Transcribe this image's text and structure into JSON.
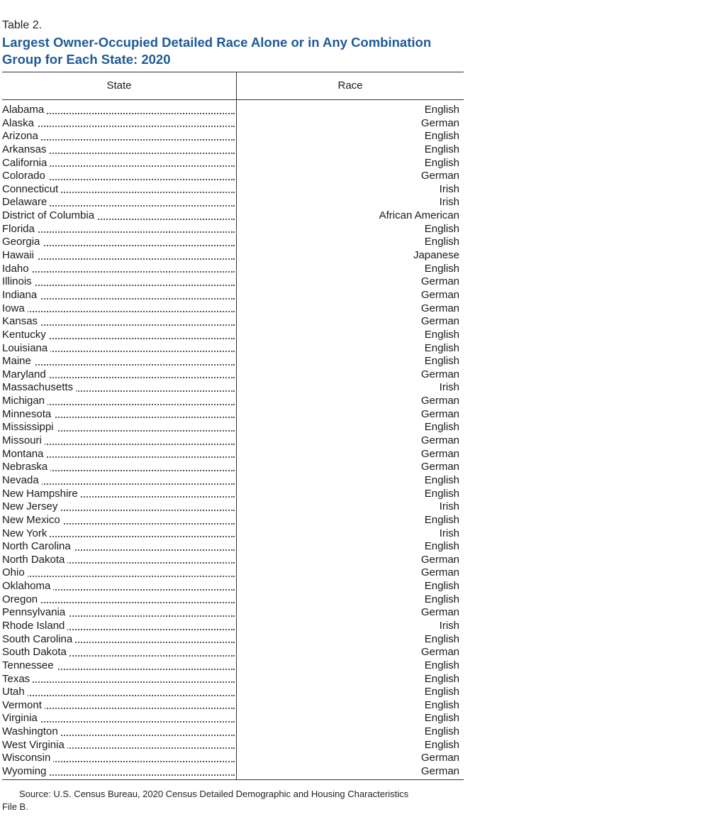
{
  "table_label": "Table 2.",
  "title": "Largest Owner-Occupied Detailed Race Alone or in Any Combination Group for Each State: 2020",
  "columns": {
    "state": "State",
    "race": "Race"
  },
  "rows": [
    {
      "state": "Alabama",
      "race": "English"
    },
    {
      "state": "Alaska",
      "race": "German"
    },
    {
      "state": "Arizona",
      "race": "English"
    },
    {
      "state": "Arkansas",
      "race": "English"
    },
    {
      "state": "California",
      "race": "English"
    },
    {
      "state": "Colorado",
      "race": "German"
    },
    {
      "state": "Connecticut",
      "race": "Irish"
    },
    {
      "state": "Delaware",
      "race": "Irish"
    },
    {
      "state": "District of Columbia",
      "race": "African American"
    },
    {
      "state": "Florida",
      "race": "English"
    },
    {
      "state": "Georgia",
      "race": "English"
    },
    {
      "state": "Hawaii",
      "race": "Japanese"
    },
    {
      "state": "Idaho",
      "race": "English"
    },
    {
      "state": "Illinois",
      "race": "German"
    },
    {
      "state": "Indiana",
      "race": "German"
    },
    {
      "state": "Iowa",
      "race": "German"
    },
    {
      "state": "Kansas",
      "race": "German"
    },
    {
      "state": "Kentucky",
      "race": "English"
    },
    {
      "state": "Louisiana",
      "race": "English"
    },
    {
      "state": "Maine",
      "race": "English"
    },
    {
      "state": "Maryland",
      "race": "German"
    },
    {
      "state": "Massachusetts",
      "race": "Irish"
    },
    {
      "state": "Michigan",
      "race": "German"
    },
    {
      "state": "Minnesota",
      "race": "German"
    },
    {
      "state": "Mississippi",
      "race": "English"
    },
    {
      "state": "Missouri",
      "race": "German"
    },
    {
      "state": "Montana",
      "race": "German"
    },
    {
      "state": "Nebraska",
      "race": "German"
    },
    {
      "state": "Nevada",
      "race": "English"
    },
    {
      "state": "New Hampshire",
      "race": "English"
    },
    {
      "state": "New Jersey",
      "race": "Irish"
    },
    {
      "state": "New Mexico",
      "race": "English"
    },
    {
      "state": "New York",
      "race": "Irish"
    },
    {
      "state": "North Carolina",
      "race": "English"
    },
    {
      "state": "North Dakota",
      "race": "German"
    },
    {
      "state": "Ohio",
      "race": "German"
    },
    {
      "state": "Oklahoma",
      "race": "English"
    },
    {
      "state": "Oregon",
      "race": "English"
    },
    {
      "state": "Pennsylvania",
      "race": "German"
    },
    {
      "state": "Rhode Island",
      "race": "Irish"
    },
    {
      "state": "South Carolina",
      "race": "English"
    },
    {
      "state": "South Dakota",
      "race": "German"
    },
    {
      "state": "Tennessee",
      "race": "English"
    },
    {
      "state": "Texas",
      "race": "English"
    },
    {
      "state": "Utah",
      "race": "English"
    },
    {
      "state": "Vermont",
      "race": "English"
    },
    {
      "state": "Virginia",
      "race": "English"
    },
    {
      "state": "Washington",
      "race": "English"
    },
    {
      "state": "West Virginia",
      "race": "English"
    },
    {
      "state": "Wisconsin",
      "race": "German"
    },
    {
      "state": "Wyoming",
      "race": "German"
    }
  ],
  "source_note": "Source: U.S. Census Bureau, 2020 Census Detailed Demographic and Housing Characteristics File B.",
  "colors": {
    "title": "#1f5a96",
    "rule": "#333333"
  }
}
